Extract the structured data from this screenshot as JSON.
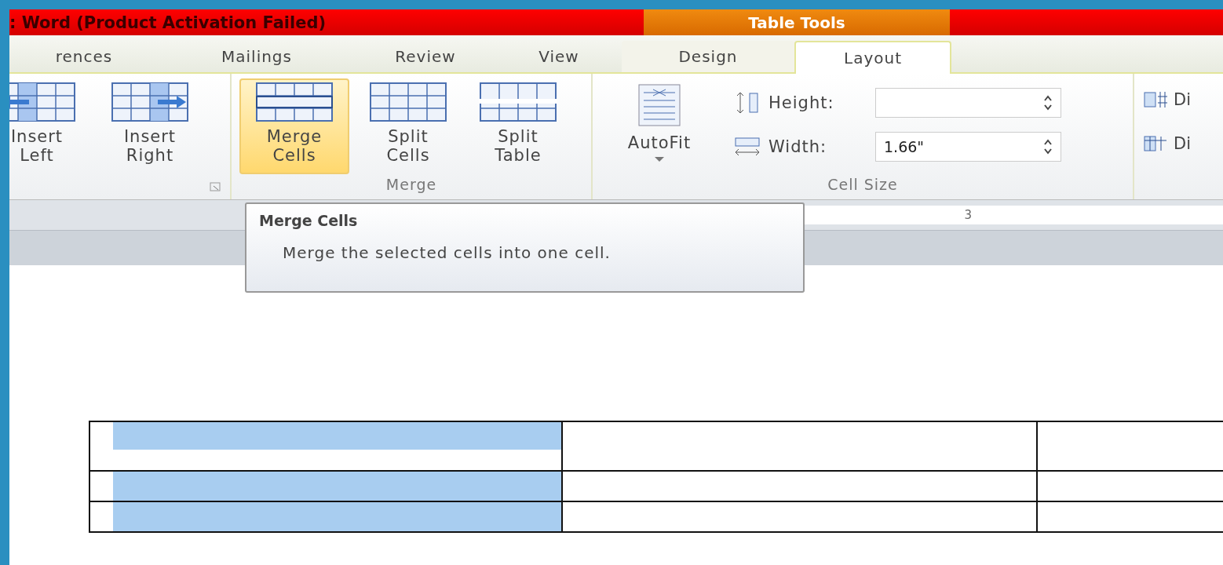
{
  "title_bar": {
    "title": ": Word (Product Activation Failed)",
    "context_tab": "Table Tools"
  },
  "tabs": [
    {
      "label": "rences",
      "selected": false
    },
    {
      "label": "Mailings",
      "selected": false
    },
    {
      "label": "Review",
      "selected": false
    },
    {
      "label": "View",
      "selected": false
    },
    {
      "label": "Design",
      "selected": false
    },
    {
      "label": "Layout",
      "selected": true
    }
  ],
  "ribbon": {
    "rows_columns": {
      "buttons": [
        {
          "label": "Insert\nLeft",
          "kind": "insert-left",
          "selected": false
        },
        {
          "label": "Insert\nRight",
          "kind": "insert-right",
          "selected": false
        }
      ]
    },
    "merge": {
      "label": "Merge",
      "buttons": [
        {
          "label": "Merge\nCells",
          "kind": "merge",
          "selected": true
        },
        {
          "label": "Split\nCells",
          "kind": "split-cells",
          "selected": false
        },
        {
          "label": "Split\nTable",
          "kind": "split-table",
          "selected": false
        }
      ]
    },
    "cell_size": {
      "label": "Cell Size",
      "autofit": "AutoFit",
      "height_label": "Height:",
      "width_label": "Width:",
      "width_value": "1.66\""
    },
    "distribute": [
      "Di",
      "Di"
    ]
  },
  "ruler": {
    "mark": "3"
  },
  "tooltip": {
    "title": "Merge Cells",
    "text": "Merge the selected cells into one cell."
  },
  "table": {
    "rows": [
      {
        "selected": true,
        "tall": true
      },
      {
        "selected": true,
        "tall": false
      },
      {
        "selected": true,
        "tall": false
      }
    ]
  }
}
